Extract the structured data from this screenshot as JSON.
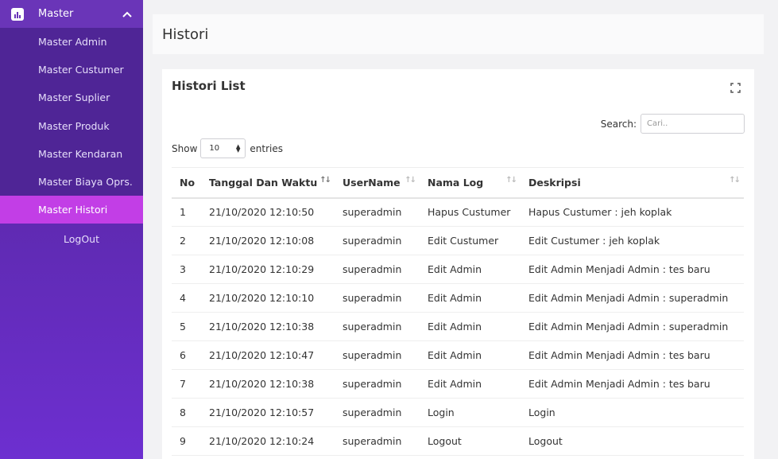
{
  "sidebar": {
    "header": "Master",
    "items": [
      {
        "label": "Master Admin"
      },
      {
        "label": "Master Custumer"
      },
      {
        "label": "Master Suplier"
      },
      {
        "label": "Master Produk"
      },
      {
        "label": "Master Kendaran"
      },
      {
        "label": "Master Biaya Oprs."
      },
      {
        "label": "Master Histori"
      }
    ],
    "logout": "LogOut"
  },
  "page": {
    "title": "Histori"
  },
  "card": {
    "title": "Histori List",
    "search_label": "Search:",
    "search_placeholder": "Cari..",
    "show_label": "Show",
    "entries_value": "10",
    "entries_label": "entries"
  },
  "table": {
    "columns": [
      "No",
      "Tanggal Dan Waktu",
      "UserName",
      "Nama Log",
      "Deskripsi"
    ],
    "rows": [
      [
        "1",
        "21/10/2020 12:10:50",
        "superadmin",
        "Hapus Custumer",
        "Hapus Custumer : jeh koplak"
      ],
      [
        "2",
        "21/10/2020 12:10:08",
        "superadmin",
        "Edit Custumer",
        "Edit Custumer : jeh koplak"
      ],
      [
        "3",
        "21/10/2020 12:10:29",
        "superadmin",
        "Edit Admin",
        "Edit Admin Menjadi Admin : tes baru"
      ],
      [
        "4",
        "21/10/2020 12:10:10",
        "superadmin",
        "Edit Admin",
        "Edit Admin Menjadi Admin : superadmin"
      ],
      [
        "5",
        "21/10/2020 12:10:38",
        "superadmin",
        "Edit Admin",
        "Edit Admin Menjadi Admin : superadmin"
      ],
      [
        "6",
        "21/10/2020 12:10:47",
        "superadmin",
        "Edit Admin",
        "Edit Admin Menjadi Admin : tes baru"
      ],
      [
        "7",
        "21/10/2020 12:10:38",
        "superadmin",
        "Edit Admin",
        "Edit Admin Menjadi Admin : tes baru"
      ],
      [
        "8",
        "21/10/2020 12:10:57",
        "superadmin",
        "Login",
        "Login"
      ],
      [
        "9",
        "21/10/2020 12:10:24",
        "superadmin",
        "Logout",
        "Logout"
      ]
    ]
  }
}
